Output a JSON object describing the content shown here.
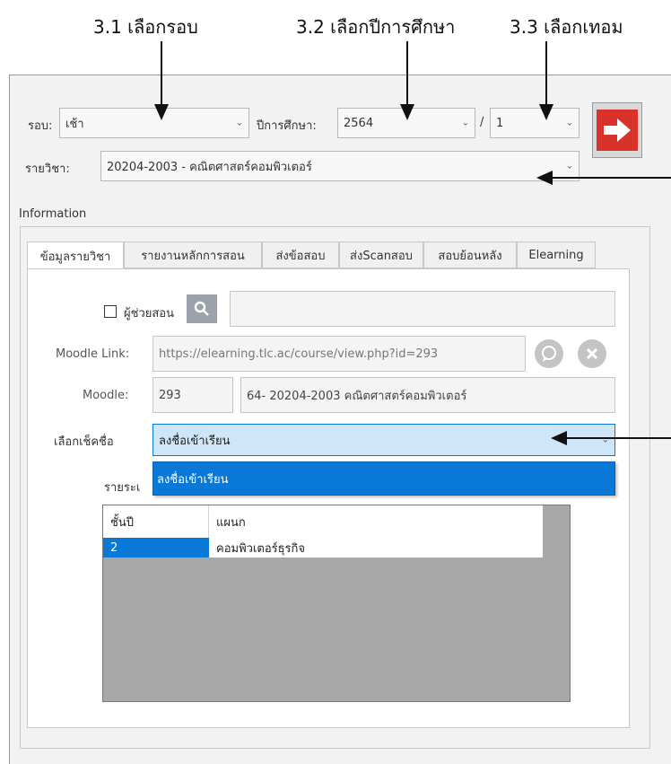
{
  "callouts": {
    "round": "3.1 เลือกรอบ",
    "year": "3.2 เลือกปีการศึกษา",
    "term": "3.3 เลือกเทอม"
  },
  "form": {
    "round_label": "รอบ:",
    "round_value": "เช้า",
    "year_label": "ปีการศึกษา:",
    "year_value": "2564",
    "slash": "/",
    "term_value": "1",
    "subject_label": "รายวิชา:",
    "subject_value": "20204-2003 - คณิตศาสตร์คอมพิวเตอร์",
    "go_icon": "arrow-right-icon"
  },
  "info": {
    "group_label": "Information",
    "tabs": [
      "ข้อมูลรายวิชา",
      "รายงานหลักการสอน",
      "ส่งข้อสอบ",
      "ส่งScanสอบ",
      "สอบย้อนหลัง",
      "Elearning"
    ],
    "assistant_checkbox_label": "ผู้ช่วยสอน",
    "moodle_link_label": "Moodle Link:",
    "moodle_link_value": "https://elearning.tlc.ac/course/view.php?id=293",
    "moodle_label": "Moodle:",
    "moodle_id": "293",
    "moodle_course": "64- 20204-2003  คณิตศาสตร์คอมพิวเตอร์",
    "checkin_label": "เลือกเช็คชื่อ",
    "checkin_value": "ลงชื่อเข้าเรียน",
    "checkin_options": [
      "ลงชื่อเข้าเรียน"
    ],
    "hidden_label_partial": "รายระเ"
  },
  "table": {
    "headers": [
      "ชั้นปี",
      "แผนก"
    ],
    "rows": [
      [
        "2",
        "คอมพิวเตอร์ธุรกิจ"
      ]
    ]
  },
  "colors": {
    "accent_blue": "#0a78d7",
    "go_red": "#d8322a",
    "dropdown_highlight": "#cfe6f8"
  }
}
